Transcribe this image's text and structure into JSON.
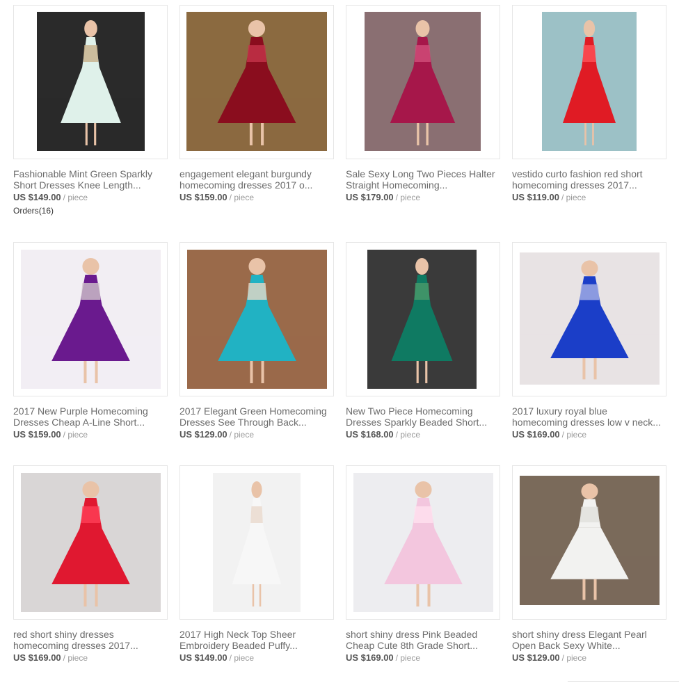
{
  "products": [
    {
      "title": "Fashionable Mint Green Sparkly Short Dresses Knee Length...",
      "price": "US $149.00",
      "unit": "/ piece",
      "orders_label": "Orders",
      "orders_count": "(16)",
      "colors": {
        "bg": "#2a2a2a",
        "dress": "#dff1ea",
        "accent": "#c7b08a"
      }
    },
    {
      "title": "engagement elegant burgundy homecoming dresses 2017 o...",
      "price": "US $159.00",
      "unit": "/ piece",
      "colors": {
        "bg": "#8b6a40",
        "dress": "#8a0d1e",
        "accent": "#c4344a"
      }
    },
    {
      "title": "Sale Sexy Long Two Pieces Halter Straight Homecoming...",
      "price": "US $179.00",
      "unit": "/ piece",
      "colors": {
        "bg": "#8a6f72",
        "dress": "#a6174a",
        "accent": "#d24f7a"
      }
    },
    {
      "title": "vestido curto fashion red short homecoming dresses 2017...",
      "price": "US $119.00",
      "unit": "/ piece",
      "colors": {
        "bg": "#9cc1c6",
        "dress": "#e01b24",
        "accent": "#ff5358"
      }
    },
    {
      "title": "2017 New Purple Homecoming Dresses Cheap A-Line Short...",
      "price": "US $159.00",
      "unit": "/ piece",
      "colors": {
        "bg": "#f2eef3",
        "dress": "#6a1a8e",
        "accent": "#cfc4cb"
      }
    },
    {
      "title": "2017 Elegant Green Homecoming Dresses See Through Back...",
      "price": "US $129.00",
      "unit": "/ piece",
      "colors": {
        "bg": "#9a6a4a",
        "dress": "#21b2c3",
        "accent": "#e9d7c6"
      }
    },
    {
      "title": "New Two Piece Homecoming Dresses Sparkly Beaded Short...",
      "price": "US $168.00",
      "unit": "/ piece",
      "colors": {
        "bg": "#3a3a3a",
        "dress": "#0f7a62",
        "accent": "#4a9a6a"
      }
    },
    {
      "title": "2017 luxury royal blue homecoming dresses low v neck...",
      "price": "US $169.00",
      "unit": "/ piece",
      "colors": {
        "bg": "#e8e3e4",
        "dress": "#1b3ec8",
        "accent": "#a7b2e6"
      }
    },
    {
      "title": "red short shiny dresses homecoming dresses 2017...",
      "price": "US $169.00",
      "unit": "/ piece",
      "colors": {
        "bg": "#d9d6d6",
        "dress": "#e01830",
        "accent": "#ff4058"
      }
    },
    {
      "title": "2017 High Neck Top Sheer Embroidery Beaded Puffy...",
      "price": "US $149.00",
      "unit": "/ piece",
      "colors": {
        "bg": "#f2f2f2",
        "dress": "#f7f7f7",
        "accent": "#e8d8cc"
      }
    },
    {
      "title": "short shiny dress Pink Beaded Cheap Cute 8th Grade Short...",
      "price": "US $169.00",
      "unit": "/ piece",
      "colors": {
        "bg": "#ededf0",
        "dress": "#f3c6de",
        "accent": "#ffe1ef"
      }
    },
    {
      "title": "short shiny dress Elegant Pearl Open Back Sexy White...",
      "price": "US $129.00",
      "unit": "/ piece",
      "colors": {
        "bg": "#7a6a5a",
        "dress": "#f2f2f0",
        "accent": "#e0e0dc"
      }
    }
  ]
}
